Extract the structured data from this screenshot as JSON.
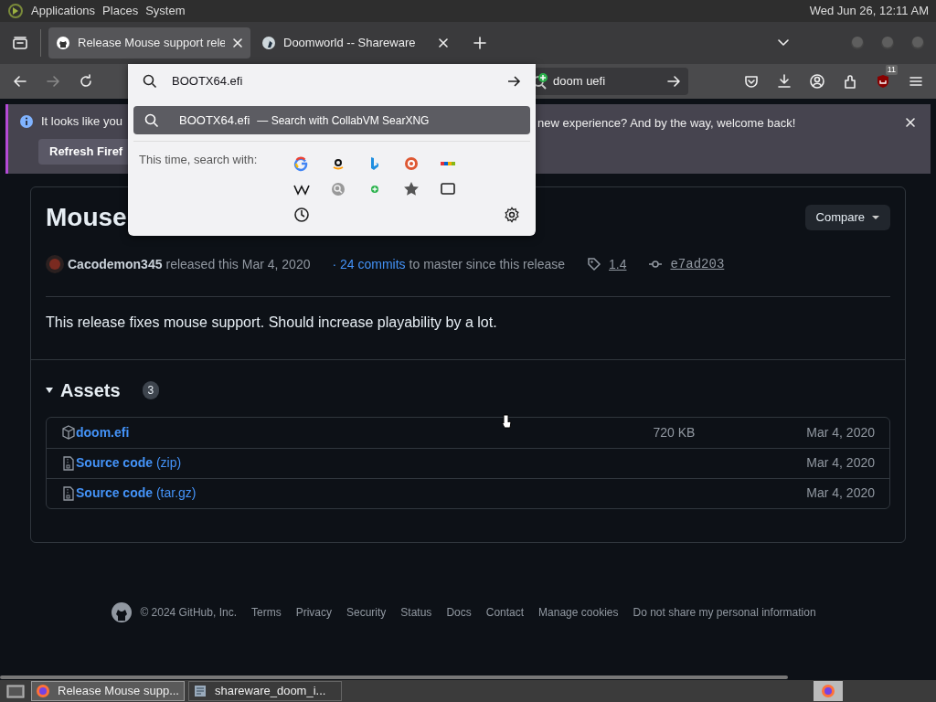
{
  "top_panel": {
    "menus": [
      "Applications",
      "Places",
      "System"
    ],
    "clock": "Wed Jun 26, 12:11 AM"
  },
  "tabs": [
    {
      "title": "Release Mouse support rele",
      "selected": true
    },
    {
      "title": "Doomworld -- Shareware",
      "selected": false
    }
  ],
  "nav_buttons": [
    {
      "kind": "back",
      "disabled": false
    },
    {
      "kind": "forward",
      "disabled": true
    },
    {
      "kind": "reload",
      "disabled": false
    }
  ],
  "url_popup": {
    "value": "BOOTX64.efi",
    "suggestion": {
      "text": "BOOTX64.efi",
      "action": "— Search with CollabVM SearXNG",
      "selected": true
    },
    "engines_label": "This time, search with:"
  },
  "search_bar": {
    "value": "doom uefi"
  },
  "extension_badge": "11",
  "notification": {
    "text_start": "It looks like you",
    "text_end": "new experience? And by the way, welcome back!",
    "button": "Refresh Firef"
  },
  "release": {
    "title": "Mouse",
    "compare": "Compare",
    "author": "Cacodemon345",
    "released": "released this Mar 4, 2020",
    "commits_link": "· 24 commits",
    "commits_text": "to master since this release",
    "tag": "1.4",
    "commit": "e7ad203",
    "body": "This release fixes mouse support. Should increase playability by a lot.",
    "assets_title": "Assets",
    "assets_count": "3",
    "assets": [
      {
        "kind": "file",
        "name": "doom.efi",
        "size": "720 KB",
        "date": "Mar 4, 2020"
      },
      {
        "kind": "source",
        "name": "Source code",
        "format": "(zip)",
        "date": "Mar 4, 2020"
      },
      {
        "kind": "source",
        "name": "Source code",
        "format": "(tar.gz)",
        "date": "Mar 4, 2020"
      }
    ]
  },
  "footer": {
    "copyright": "© 2024 GitHub, Inc.",
    "links": [
      "Terms",
      "Privacy",
      "Security",
      "Status",
      "Docs",
      "Contact",
      "Manage cookies",
      "Do not share my personal information"
    ]
  },
  "taskbar": {
    "tasks": [
      {
        "title": "Release Mouse supp...",
        "selected": true
      },
      {
        "title": "shareware_doom_i...",
        "selected": false
      }
    ]
  }
}
